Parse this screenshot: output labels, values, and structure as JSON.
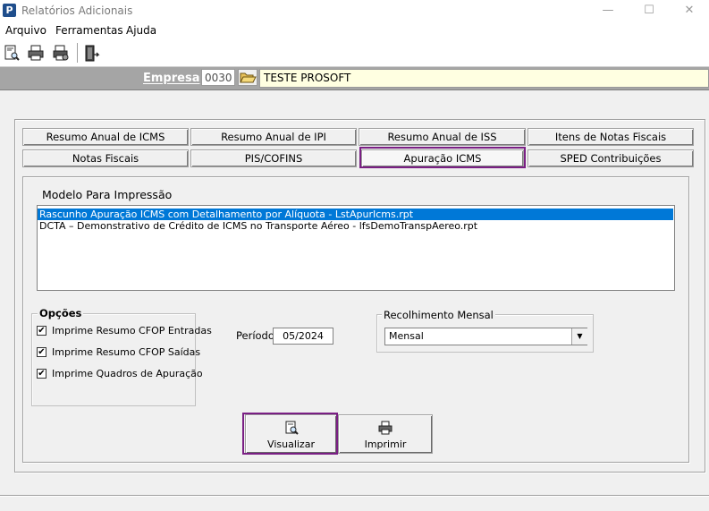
{
  "window": {
    "title": "Relatórios Adicionais",
    "app_icon_letter": "P",
    "minimize": "—",
    "maximize": "☐",
    "close": "✕"
  },
  "menu": [
    "Arquivo",
    "Ferramentas",
    "Ajuda"
  ],
  "toolbar": {
    "icons": [
      "preview-report-icon",
      "print-icon",
      "print-setup-icon",
      "exit-door-icon"
    ]
  },
  "empresa": {
    "label": "Empresa",
    "code": "0030",
    "name": "TESTE PROSOFT"
  },
  "tabs": {
    "row1": [
      "Resumo Anual de ICMS",
      "Resumo Anual de IPI",
      "Resumo Anual de ISS",
      "Itens de Notas Fiscais"
    ],
    "row2": [
      "Notas Fiscais",
      "PIS/COFINS",
      "Apuração ICMS",
      "SPED Contribuições"
    ],
    "active": "Apuração ICMS"
  },
  "modelo": {
    "label": "Modelo Para Impressão",
    "items": [
      "Rascunho Apuração ICMS com Detalhamento por Alíquota - LstApurIcms.rpt",
      "DCTA – Demonstrativo de Crédito de ICMS no Transporte Aéreo - lfsDemoTranspAereo.rpt"
    ],
    "selected_index": 0
  },
  "opcoes": {
    "legend": "Opções",
    "items": [
      {
        "label": "Imprime Resumo CFOP Entradas",
        "checked": true
      },
      {
        "label": "Imprime Resumo CFOP Saídas",
        "checked": true
      },
      {
        "label": "Imprime Quadros de Apuração",
        "checked": true
      }
    ]
  },
  "periodo": {
    "label": "Período",
    "value": "05/2024"
  },
  "recolhimento": {
    "legend": "Recolhimento Mensal",
    "selected": "Mensal"
  },
  "actions": {
    "visualizar": "Visualizar",
    "imprimir": "Imprimir"
  },
  "colors": {
    "highlight": "#7a1f84",
    "selection": "#0078d7",
    "empresa_bar": "#a5a5a5",
    "empresa_name_bg": "#ffffe1"
  }
}
